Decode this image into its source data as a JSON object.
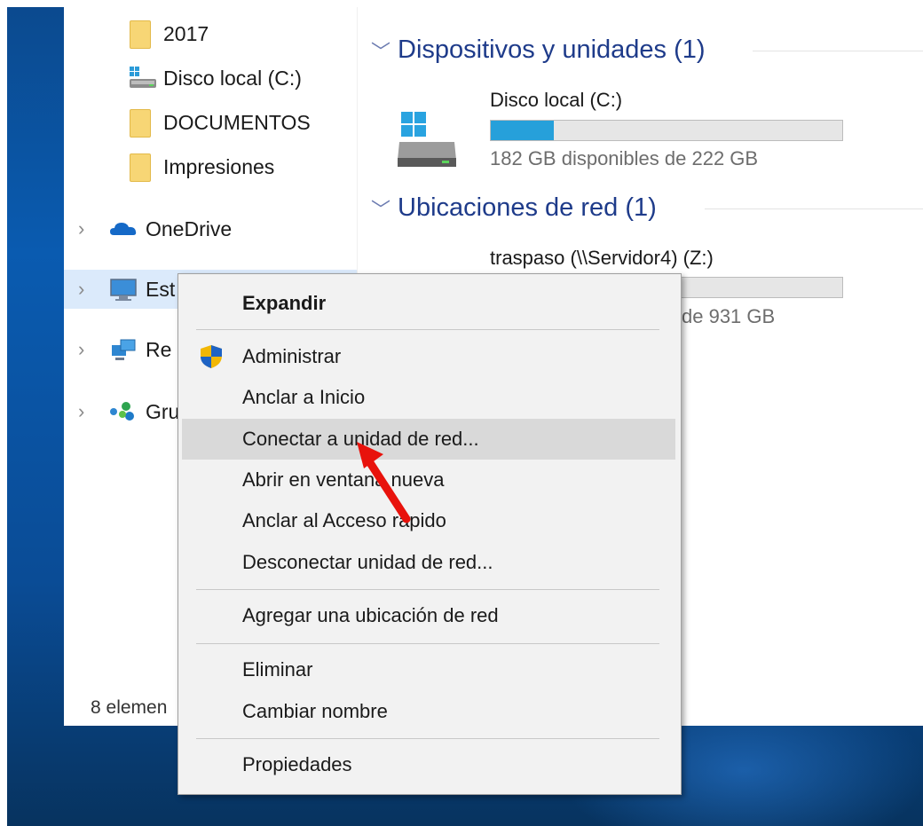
{
  "nav": {
    "items": [
      {
        "label": "2017",
        "icon": "folder-icon"
      },
      {
        "label": "Disco local (C:)",
        "icon": "drive-icon"
      },
      {
        "label": "DOCUMENTOS",
        "icon": "folder-icon"
      },
      {
        "label": "Impresiones",
        "icon": "folder-icon"
      },
      {
        "label": "OneDrive",
        "icon": "onedrive-icon"
      },
      {
        "label": "Est",
        "icon": "pc-icon"
      },
      {
        "label": "Re",
        "icon": "network-icon"
      },
      {
        "label": "Gru",
        "icon": "homegroup-icon"
      }
    ]
  },
  "status": {
    "text": "8 elemen"
  },
  "content": {
    "devices_header": "Dispositivos y unidades (1)",
    "local_drive": {
      "name": "Disco local (C:)",
      "free_text": "182 GB disponibles de 222 GB",
      "used_fraction": 0.18
    },
    "network_header": "Ubicaciones de red (1)",
    "network_drive": {
      "name": "traspaso (\\\\Servidor4) (Z:)",
      "free_text": "de 931 GB",
      "used_fraction": 0.05
    }
  },
  "context_menu": {
    "expand": "Expandir",
    "manage": "Administrar",
    "pin_start": "Anclar a Inicio",
    "map_drive": "Conectar a unidad de red...",
    "open_new_window": "Abrir en ventana nueva",
    "pin_quick_access": "Anclar al Acceso rápido",
    "disconnect_drive": "Desconectar unidad de red...",
    "add_network_location": "Agregar una ubicación de red",
    "delete": "Eliminar",
    "rename": "Cambiar nombre",
    "properties": "Propiedades"
  },
  "colors": {
    "accent": "#26a0da",
    "annotation_arrow": "#e8120c",
    "selection": "#dbeafb",
    "header_text": "#1e3b8a"
  }
}
